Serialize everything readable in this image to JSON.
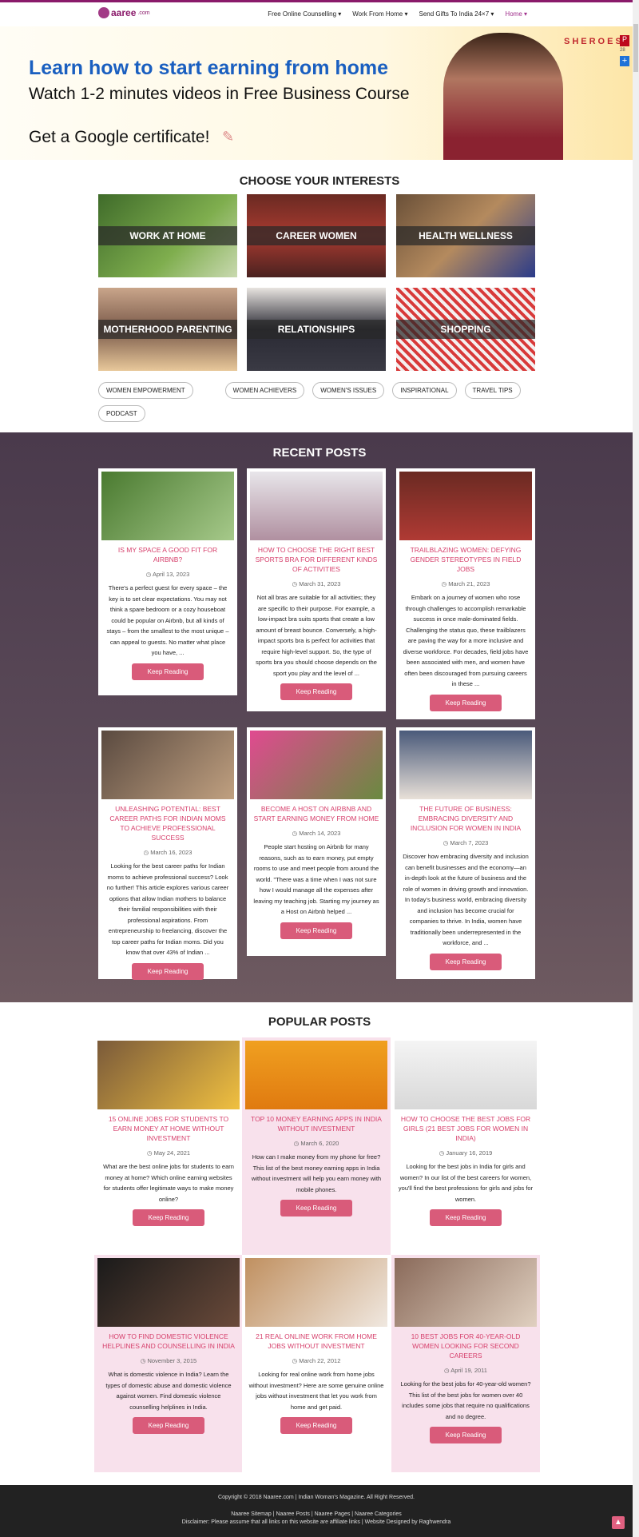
{
  "nav": {
    "logo": "aaree",
    "logo_suffix": ".com",
    "items": [
      {
        "label": "Free Online Counselling ▾"
      },
      {
        "label": "Work From Home ▾"
      },
      {
        "label": "Send Gifts To India 24×7 ▾"
      },
      {
        "label": "Home ▾"
      }
    ]
  },
  "banner": {
    "headline": "Learn how to start earning from home",
    "subline": "Watch 1-2 minutes videos in Free Business Course",
    "cta": "Get a Google certificate!",
    "brand": "SHEROES",
    "share_count": "28"
  },
  "interests": {
    "title": "CHOOSE YOUR INTERESTS",
    "tiles": [
      {
        "label": "WORK AT HOME"
      },
      {
        "label": "CAREER WOMEN"
      },
      {
        "label": "HEALTH WELLNESS"
      },
      {
        "label": "MOTHERHOOD PARENTING"
      },
      {
        "label": "RELATIONSHIPS"
      },
      {
        "label": "SHOPPING"
      }
    ],
    "tags": [
      "WOMEN EMPOWERMENT",
      "WOMEN ACHIEVERS",
      "WOMEN'S ISSUES",
      "INSPIRATIONAL",
      "TRAVEL TIPS",
      "PODCAST"
    ]
  },
  "recent": {
    "title": "RECENT POSTS",
    "button": "Keep Reading",
    "posts": [
      {
        "title": "IS MY SPACE A GOOD FIT FOR AIRBNB?",
        "date": "April 13, 2023",
        "excerpt": "There's a perfect guest for every space – the key is to set clear expectations. You may not think a spare bedroom or a cozy houseboat could be popular on Airbnb, but all kinds of stays – from the smallest to the most unique – can appeal to guests. No matter what place you have, ..."
      },
      {
        "title": "HOW TO CHOOSE THE RIGHT BEST SPORTS BRA FOR DIFFERENT KINDS OF ACTIVITIES",
        "date": "March 31, 2023",
        "excerpt": "Not all bras are suitable for all activities; they are specific to their purpose. For example, a low-impact bra suits sports that create a low amount of breast bounce. Conversely, a high-impact sports bra is perfect for activities that require high-level support. So, the type of sports bra you should choose depends on the sport you play and the level of ..."
      },
      {
        "title": "TRAILBLAZING WOMEN: DEFYING GENDER STEREOTYPES IN FIELD JOBS",
        "date": "March 21, 2023",
        "excerpt": "Embark on a journey of women who rose through challenges to accomplish remarkable success in once male-dominated fields. Challenging the status quo, these trailblazers are paving the way for a more inclusive and diverse workforce. For decades, field jobs have been associated with men, and women have often been discouraged from pursuing careers in these ..."
      },
      {
        "title": "UNLEASHING POTENTIAL: BEST CAREER PATHS FOR INDIAN MOMS TO ACHIEVE PROFESSIONAL SUCCESS",
        "date": "March 16, 2023",
        "excerpt": "Looking for the best career paths for Indian moms to achieve professional success? Look no further! This article explores various career options that allow Indian mothers to balance their familial responsibilities with their professional aspirations. From entrepreneurship to freelancing, discover the top career paths for Indian moms. Did you know that over 43% of Indian ..."
      },
      {
        "title": "BECOME A HOST ON AIRBNB AND START EARNING MONEY FROM HOME",
        "date": "March 14, 2023",
        "excerpt": "People start hosting on Airbnb for many reasons, such as to earn money, put empty rooms to use and meet people from around the world. \"There was a time when I was not sure how I would manage all the expenses after leaving my teaching job. Starting my journey as a Host on Airbnb helped ..."
      },
      {
        "title": "THE FUTURE OF BUSINESS: EMBRACING DIVERSITY AND INCLUSION FOR WOMEN IN INDIA",
        "date": "March 7, 2023",
        "excerpt": "Discover how embracing diversity and inclusion can benefit businesses and the economy—an in-depth look at the future of business and the role of women in driving growth and innovation. In today's business world, embracing diversity and inclusion has become crucial for companies to thrive. In India, women have traditionally been underrepresented in the workforce, and ..."
      }
    ]
  },
  "popular": {
    "title": "POPULAR POSTS",
    "button": "Keep Reading",
    "posts": [
      {
        "title": "15 ONLINE JOBS FOR STUDENTS TO EARN MONEY AT HOME WITHOUT INVESTMENT",
        "date": "May 24, 2021",
        "excerpt": "What are the best online jobs for students to earn money at home? Which online earning websites for students offer legitimate ways to make money online?"
      },
      {
        "title": "TOP 10 MONEY EARNING APPS IN INDIA WITHOUT INVESTMENT",
        "date": "March 6, 2020",
        "excerpt": "How can I make money from my phone for free? This list of the best money earning apps in India without investment will help you earn money with mobile phones."
      },
      {
        "title": "HOW TO CHOOSE THE BEST JOBS FOR GIRLS (21 BEST JOBS FOR WOMEN IN INDIA)",
        "date": "January 16, 2019",
        "excerpt": "Looking for the best jobs in India for girls and women? In our list of the best careers for women, you'll find the best professions for girls and jobs for women."
      },
      {
        "title": "HOW TO FIND DOMESTIC VIOLENCE HELPLINES AND COUNSELLING IN INDIA",
        "date": "November 3, 2015",
        "excerpt": "What is domestic violence in India? Learn the types of domestic abuse and domestic violence against women. Find domestic violence counselling helplines in India."
      },
      {
        "title": "21 REAL ONLINE WORK FROM HOME JOBS WITHOUT INVESTMENT",
        "date": "March 22, 2012",
        "excerpt": "Looking for real online work from home jobs without investment? Here are some genuine online jobs without investment that let you work from home and get paid."
      },
      {
        "title": "10 BEST JOBS FOR 40-YEAR-OLD WOMEN LOOKING FOR SECOND CAREERS",
        "date": "April 19, 2011",
        "excerpt": "Looking for the best jobs for 40-year-old women? This list of the best jobs for women over 40 includes some jobs that require no qualifications and no degree."
      }
    ]
  },
  "footer": {
    "copyright": "Copyright © 2018 Naaree.com | Indian Woman's Magazine. All Right Reserved.",
    "links": "Naaree Sitemap | Naaree Posts | Naaree Pages | Naaree Categories",
    "disclaimer": "Disclaimer: Please assume that all links on this website are affiliate links | Website Designed by Raghwendra"
  },
  "colors": {
    "accent": "#d63f6b",
    "button": "#d95b7a",
    "brand": "#8a1a6a",
    "highlight": "#f8e1ec"
  }
}
